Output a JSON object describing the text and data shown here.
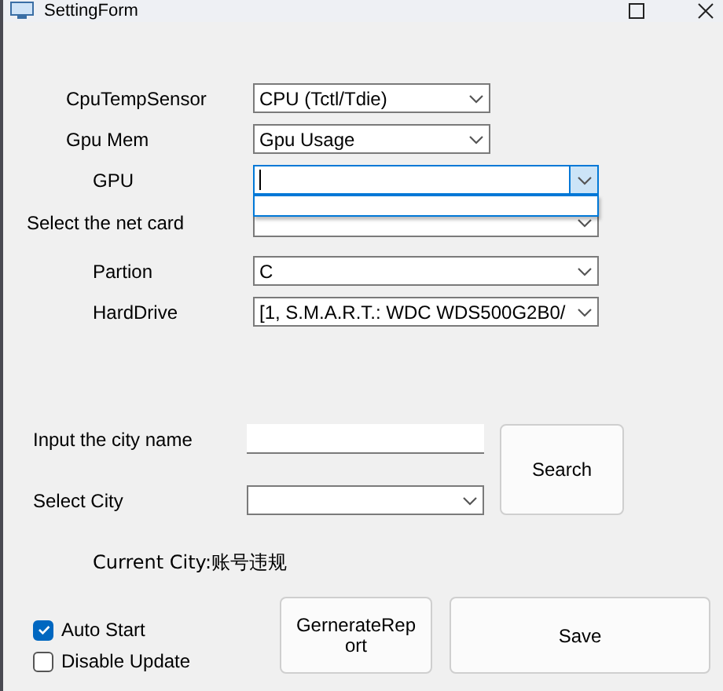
{
  "window": {
    "title": "SettingForm"
  },
  "selectors": [
    {
      "label": "CpuTempSensor",
      "value": "CPU (Tctl/Tdie)",
      "open": false
    },
    {
      "label": "Gpu Mem",
      "value": "Gpu Usage",
      "open": false
    },
    {
      "label": "GPU",
      "open": true
    },
    {
      "label": "Select the net card",
      "open": false
    },
    {
      "label": "Partion",
      "value": "C",
      "open": false
    },
    {
      "label": "HardDrive",
      "value": "[1, S.M.A.R.T.: WDC WDS500G2B0/",
      "open": false
    }
  ],
  "city_input": {
    "label": "Input the city name"
  },
  "search_button": "Search",
  "city_select": {
    "label": "Select City"
  },
  "current_city": "Current City:账号违规",
  "checkboxes": [
    {
      "label": "Auto Start",
      "checked": true
    },
    {
      "label": "Disable Update",
      "checked": false
    }
  ],
  "buttons": [
    "GernerateReport",
    "Save"
  ]
}
